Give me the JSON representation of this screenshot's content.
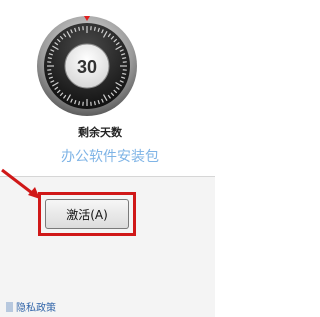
{
  "gauge": {
    "days_remaining": "30"
  },
  "labels": {
    "days_remaining_label": "剩余天数",
    "watermark": "办公软件安装包"
  },
  "buttons": {
    "activate_label": "激活(A)"
  },
  "footer": {
    "privacy_link": "隐私政策"
  },
  "colors": {
    "highlight": "#d01818",
    "arrow": "#d01818",
    "gauge_marker": "#e02020",
    "watermark": "#7fb4e6"
  },
  "icons": [
    "timer-dial-icon",
    "arrow-pointer-icon",
    "document-icon"
  ]
}
